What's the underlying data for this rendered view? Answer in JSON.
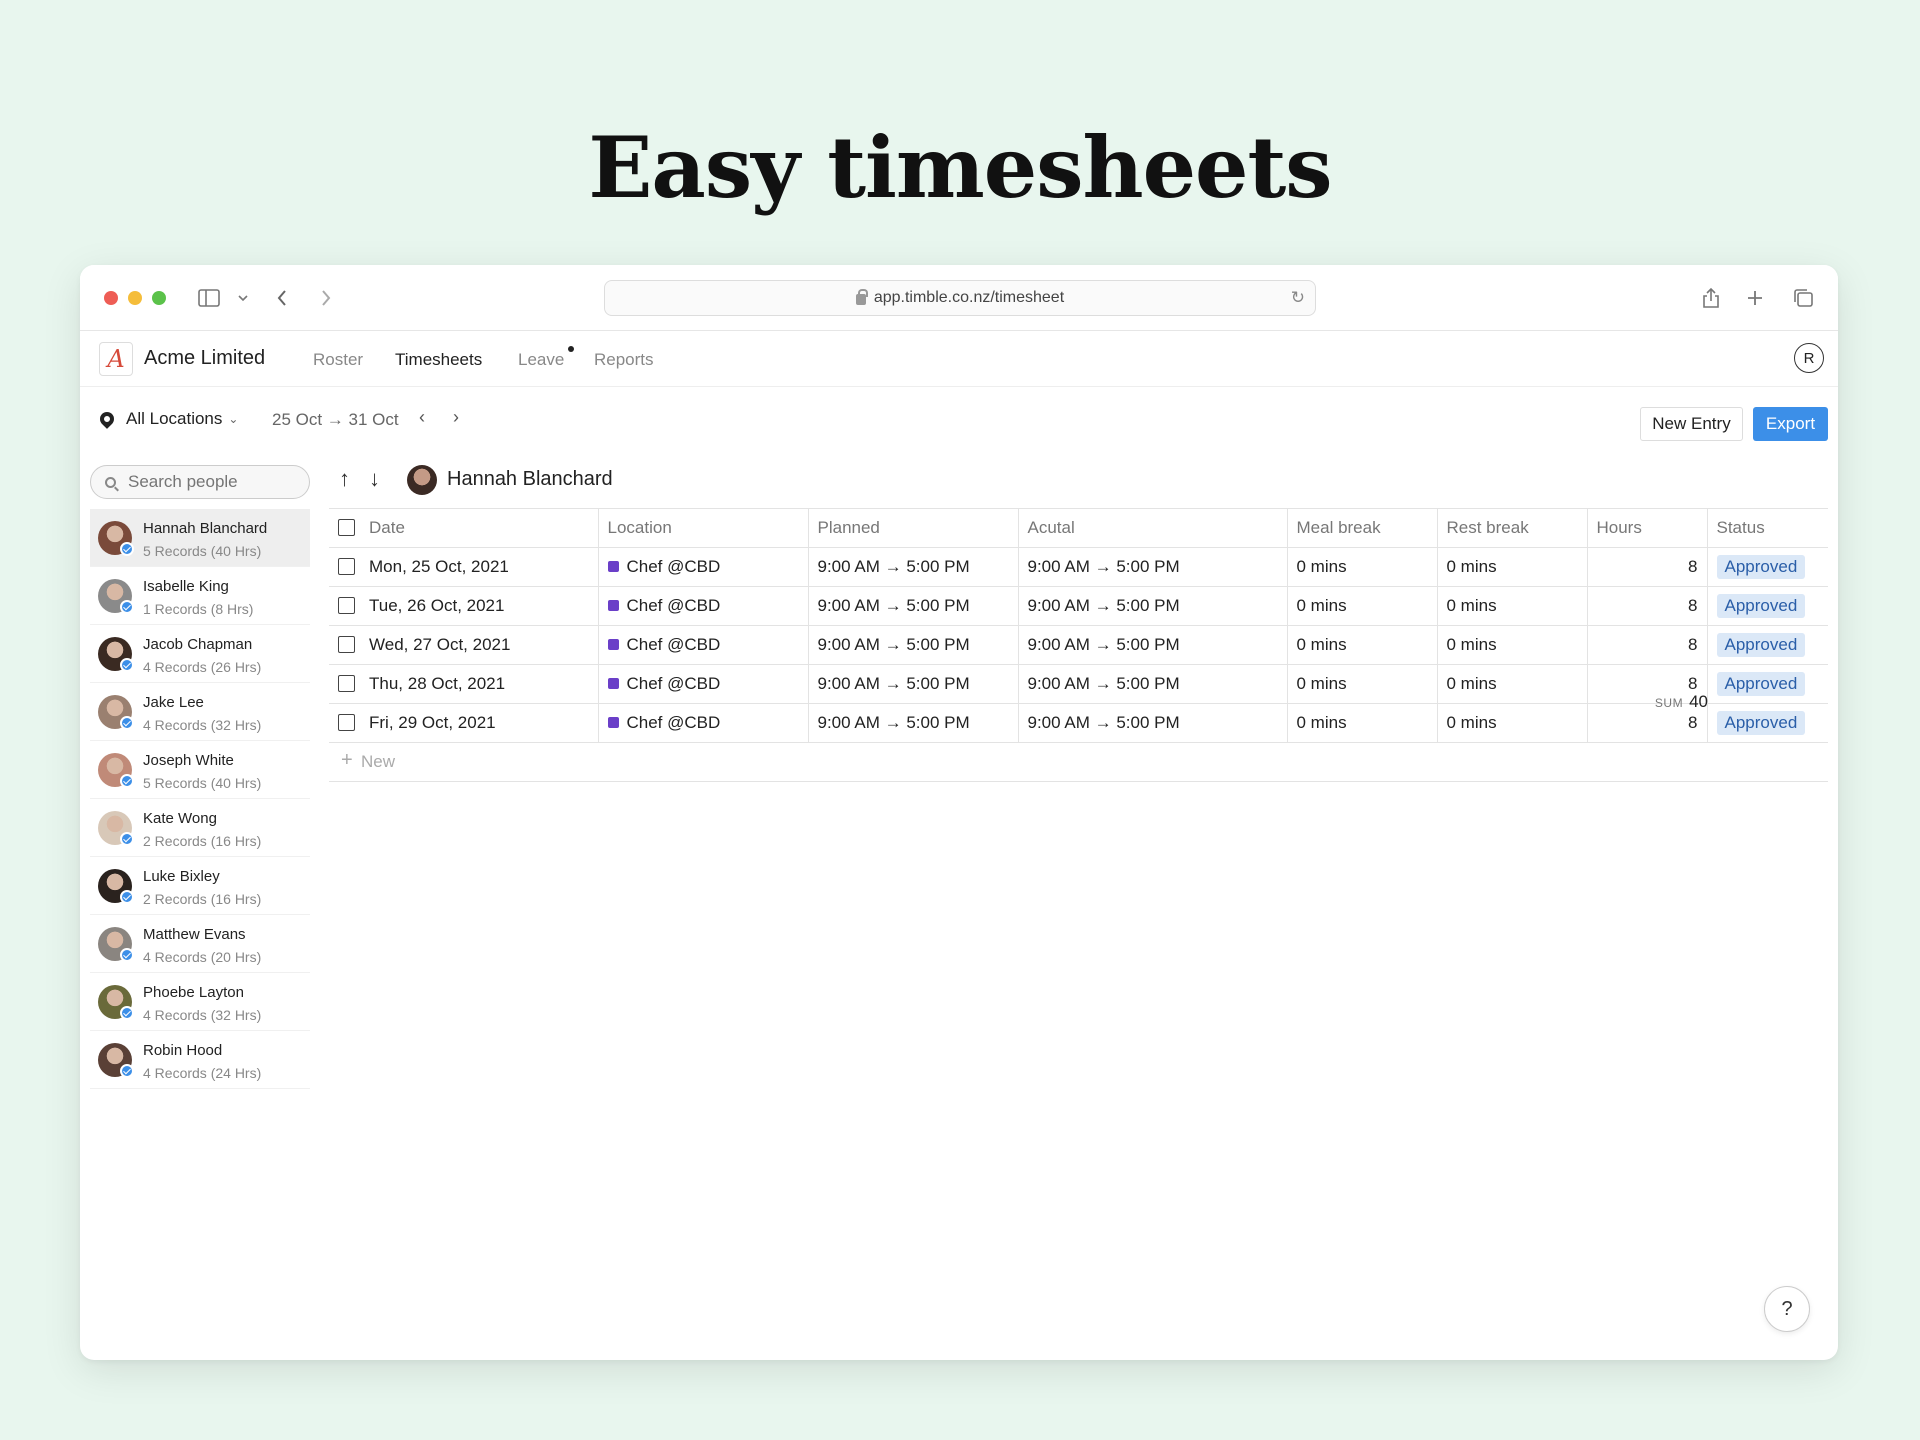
{
  "headline": "Easy timesheets",
  "browser": {
    "url": "app.timble.co.nz/timesheet"
  },
  "app": {
    "company": "Acme Limited",
    "nav": [
      "Roster",
      "Timesheets",
      "Leave",
      "Reports"
    ],
    "active_nav": "Timesheets",
    "user_initial": "R"
  },
  "toolbar": {
    "location": "All Locations",
    "date_range": "25 Oct → 31 Oct",
    "new_entry_label": "New Entry",
    "export_label": "Export"
  },
  "sidebar": {
    "search_placeholder": "Search people",
    "people": [
      {
        "name": "Hannah Blanchard",
        "records": "5 Records (40 Hrs)",
        "avatar_color": "#7a4a3a"
      },
      {
        "name": "Isabelle King",
        "records": "1 Records (8 Hrs)",
        "avatar_color": "#8a8a8a"
      },
      {
        "name": "Jacob Chapman",
        "records": "4 Records (26 Hrs)",
        "avatar_color": "#3a2a22"
      },
      {
        "name": "Jake Lee",
        "records": "4 Records (32 Hrs)",
        "avatar_color": "#9a8070"
      },
      {
        "name": "Joseph White",
        "records": "5 Records (40 Hrs)",
        "avatar_color": "#c08a78"
      },
      {
        "name": "Kate Wong",
        "records": "2 Records (16 Hrs)",
        "avatar_color": "#d8c8b8"
      },
      {
        "name": "Luke Bixley",
        "records": "2 Records (16 Hrs)",
        "avatar_color": "#2a221e"
      },
      {
        "name": "Matthew Evans",
        "records": "4 Records (20 Hrs)",
        "avatar_color": "#8a8580"
      },
      {
        "name": "Phoebe Layton",
        "records": "4 Records (32 Hrs)",
        "avatar_color": "#6a6a3a"
      },
      {
        "name": "Robin Hood",
        "records": "4 Records (24 Hrs)",
        "avatar_color": "#5a4036"
      }
    ]
  },
  "main": {
    "selected_person": "Hannah Blanchard",
    "columns": [
      "Date",
      "Location",
      "Planned",
      "Acutal",
      "Meal break",
      "Rest break",
      "Hours",
      "Status"
    ],
    "rows": [
      {
        "date": "Mon, 25 Oct, 2021",
        "location": "Chef @CBD",
        "planned": "9:00 AM → 5:00 PM",
        "actual": "9:00 AM → 5:00 PM",
        "meal": "0 mins",
        "rest": "0 mins",
        "hours": "8",
        "status": "Approved"
      },
      {
        "date": "Tue, 26 Oct, 2021",
        "location": "Chef @CBD",
        "planned": "9:00 AM → 5:00 PM",
        "actual": "9:00 AM → 5:00 PM",
        "meal": "0 mins",
        "rest": "0 mins",
        "hours": "8",
        "status": "Approved"
      },
      {
        "date": "Wed, 27 Oct, 2021",
        "location": "Chef @CBD",
        "planned": "9:00 AM → 5:00 PM",
        "actual": "9:00 AM → 5:00 PM",
        "meal": "0 mins",
        "rest": "0 mins",
        "hours": "8",
        "status": "Approved"
      },
      {
        "date": "Thu, 28 Oct, 2021",
        "location": "Chef @CBD",
        "planned": "9:00 AM → 5:00 PM",
        "actual": "9:00 AM → 5:00 PM",
        "meal": "0 mins",
        "rest": "0 mins",
        "hours": "8",
        "status": "Approved"
      },
      {
        "date": "Fri, 29 Oct, 2021",
        "location": "Chef @CBD",
        "planned": "9:00 AM → 5:00 PM",
        "actual": "9:00 AM → 5:00 PM",
        "meal": "0 mins",
        "rest": "0 mins",
        "hours": "8",
        "status": "Approved"
      }
    ],
    "new_label": "New",
    "sum_label": "SUM",
    "sum_value": "40"
  },
  "help_label": "?",
  "colors": {
    "background": "#e8f6ee",
    "accent": "#3c8fe8",
    "location_tag": "#6a3fc8",
    "status_bg": "#dbe8f7"
  }
}
